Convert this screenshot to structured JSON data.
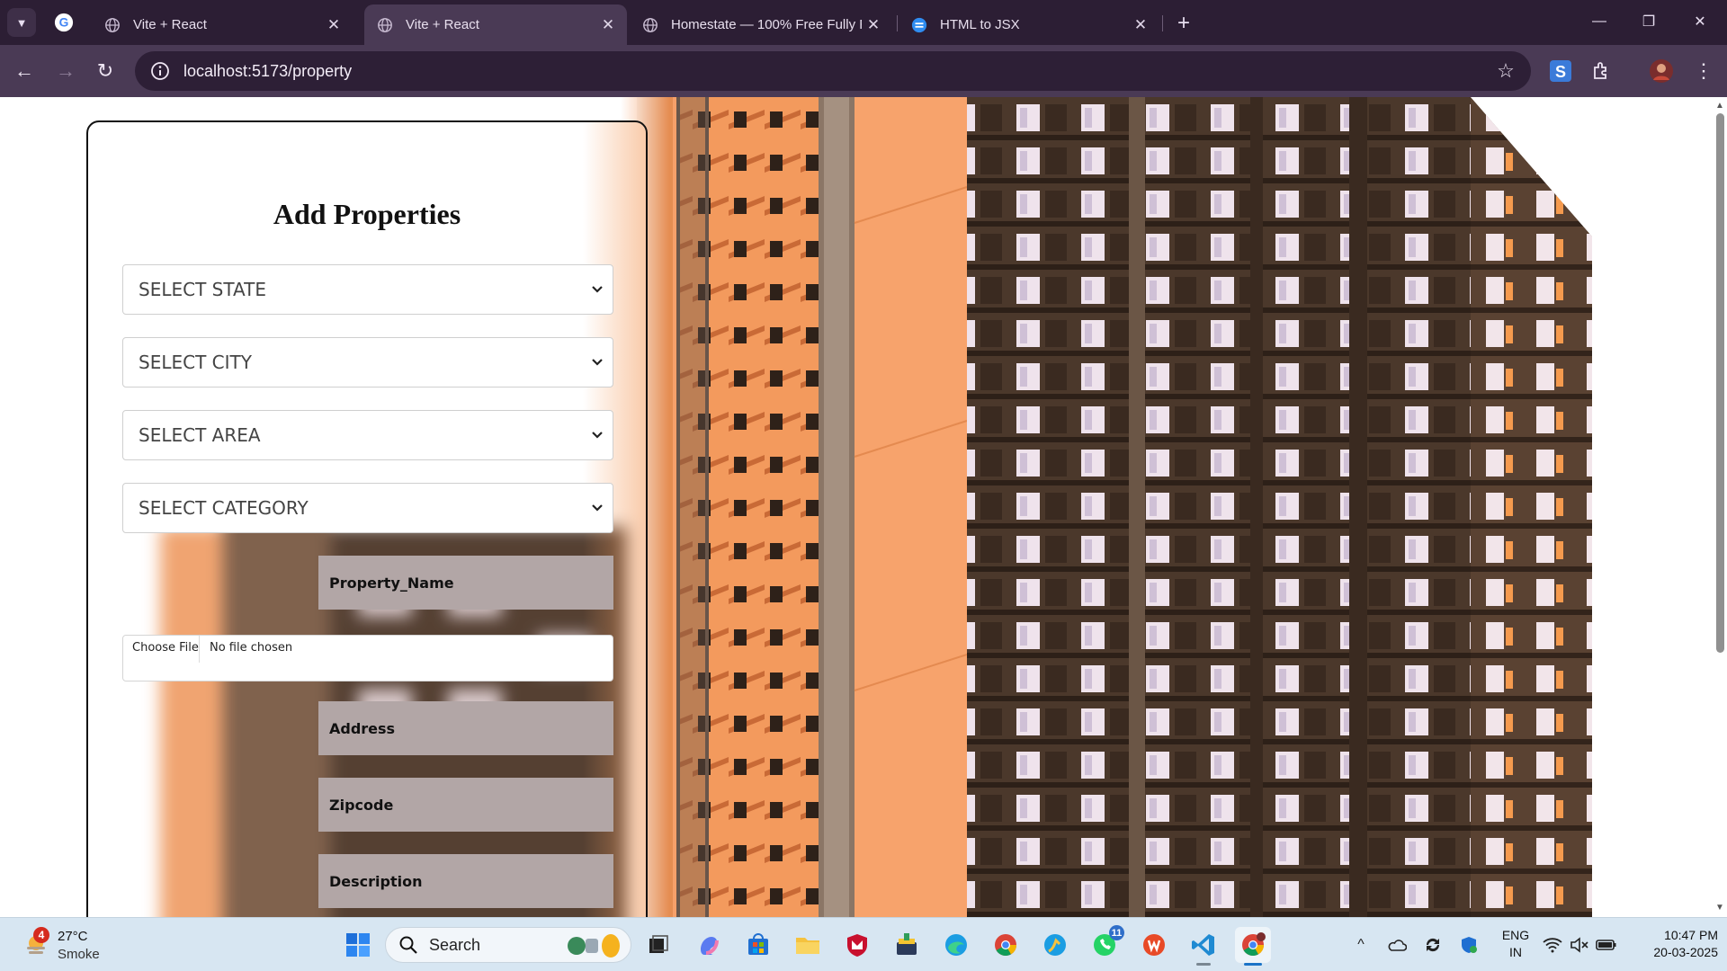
{
  "browser": {
    "tabs": [
      {
        "title": "Vite + React",
        "active": false,
        "icon": "globe-icon"
      },
      {
        "title": "Vite + React",
        "active": true,
        "icon": "globe-icon"
      },
      {
        "title": "Homestate — 100% Free Fully R",
        "active": false,
        "icon": "globe-icon"
      },
      {
        "title": "HTML to JSX",
        "active": false,
        "icon": "transform-icon"
      }
    ],
    "close_glyph": "✕",
    "new_tab_glyph": "+",
    "url": "localhost:5173/property",
    "window_controls": {
      "minimize": "—",
      "restore": "❐",
      "close": "✕"
    }
  },
  "form": {
    "title": "Add Properties",
    "selects": [
      {
        "name": "state",
        "value": "SELECT STATE"
      },
      {
        "name": "city",
        "value": "SELECT CITY"
      },
      {
        "name": "area",
        "value": "SELECT AREA"
      },
      {
        "name": "category",
        "value": "SELECT CATEGORY"
      }
    ],
    "fields": {
      "property_name": "Property_Name",
      "address": "Address",
      "zipcode": "Zipcode",
      "description": "Description"
    },
    "file": {
      "button": "Choose File",
      "status": "No file chosen"
    }
  },
  "taskbar": {
    "weather": {
      "temp": "27°C",
      "condition": "Smoke",
      "badge": "4"
    },
    "search_label": "Search",
    "whatsapp_badge": "11",
    "apps": [
      "start-icon",
      "file-explorer-icon",
      "copilot-icon",
      "store-icon",
      "folder-icon",
      "mcafee-icon",
      "app-icon",
      "edge-icon",
      "chrome-icon",
      "skype-icon",
      "whatsapp-icon",
      "office-icon",
      "vscode-icon",
      "chrome-profile-icon"
    ],
    "language": {
      "line1": "ENG",
      "line2": "IN"
    },
    "clock": {
      "time": "10:47 PM",
      "date": "20-03-2025"
    }
  },
  "colors": {
    "tabstrip": "#2c1e34",
    "toolbar": "#4a3a55",
    "field_bg": "#b2a6a6",
    "building_orange": "#f5995a",
    "building_brown": "#4a3528",
    "taskbar": "#d7e6f2"
  }
}
